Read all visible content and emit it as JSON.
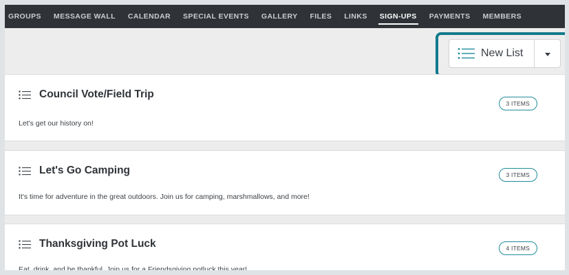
{
  "nav": {
    "items": [
      {
        "label": "GROUPS",
        "active": false
      },
      {
        "label": "MESSAGE WALL",
        "active": false
      },
      {
        "label": "CALENDAR",
        "active": false
      },
      {
        "label": "SPECIAL EVENTS",
        "active": false
      },
      {
        "label": "GALLERY",
        "active": false
      },
      {
        "label": "FILES",
        "active": false
      },
      {
        "label": "LINKS",
        "active": false
      },
      {
        "label": "SIGN-UPS",
        "active": true
      },
      {
        "label": "PAYMENTS",
        "active": false
      },
      {
        "label": "MEMBERS",
        "active": false
      }
    ]
  },
  "toolbar": {
    "new_list_label": "New List",
    "new_list_icon": "list-icon",
    "dropdown_icon": "caret-down-icon",
    "highlight_color": "#137a8c"
  },
  "lists": [
    {
      "title": "Council Vote/Field Trip",
      "description": "Let's get our history on!",
      "badge": "3 ITEMS"
    },
    {
      "title": "Let's Go Camping",
      "description": "It's time for adventure in the great outdoors. Join us for camping, marshmallows, and more!",
      "badge": "3 ITEMS"
    },
    {
      "title": "Thanksgiving Pot Luck",
      "description": "Eat, drink, and be thankful. Join us for a Friendsgiving potluck this year!",
      "badge": "4 ITEMS"
    }
  ],
  "colors": {
    "nav_bg": "#2f3236",
    "accent": "#1f8a9b"
  }
}
